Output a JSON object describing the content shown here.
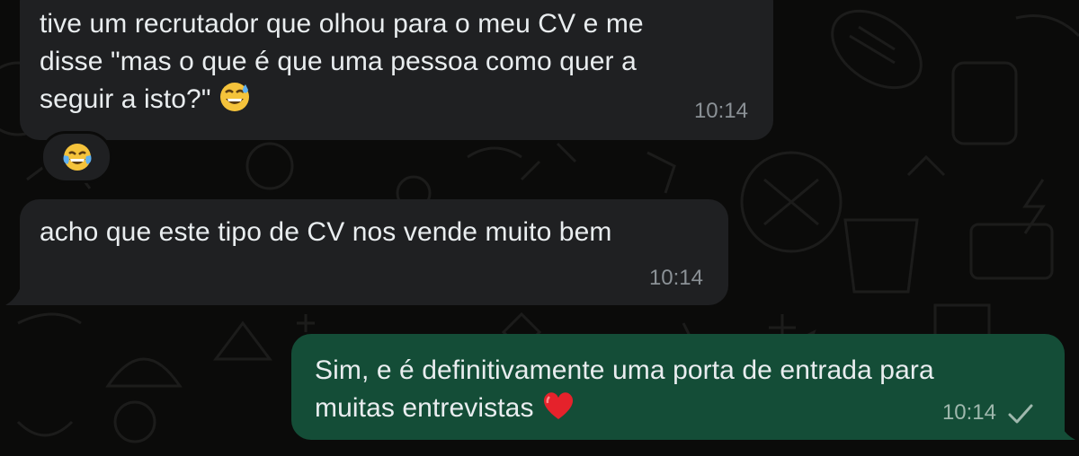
{
  "messages": [
    {
      "direction": "incoming",
      "line1": "tive um recrutador que olhou para o meu CV e me",
      "line2": "disse \"mas o que é que uma pessoa como quer a",
      "line3": "seguir a isto?\"",
      "trailing_emoji": "grinning-sweat-emoji",
      "time": "10:14",
      "reaction": "tears-of-joy-emoji"
    },
    {
      "direction": "incoming",
      "line1": "acho que este tipo de CV nos vende muito bem",
      "time": "10:14"
    },
    {
      "direction": "outgoing",
      "line1": "Sim, e é definitivamente uma porta de entrada para",
      "line2": "muitas entrevistas",
      "trailing_emoji": "red-heart-emoji",
      "time": "10:14",
      "status": "sent-checkmark-icon"
    }
  ],
  "colors": {
    "background": "#0b0b0a",
    "incoming_bubble": "#1f2022",
    "outgoing_bubble": "#144d37",
    "text": "#e9edef",
    "timestamp": "#8b9196"
  }
}
